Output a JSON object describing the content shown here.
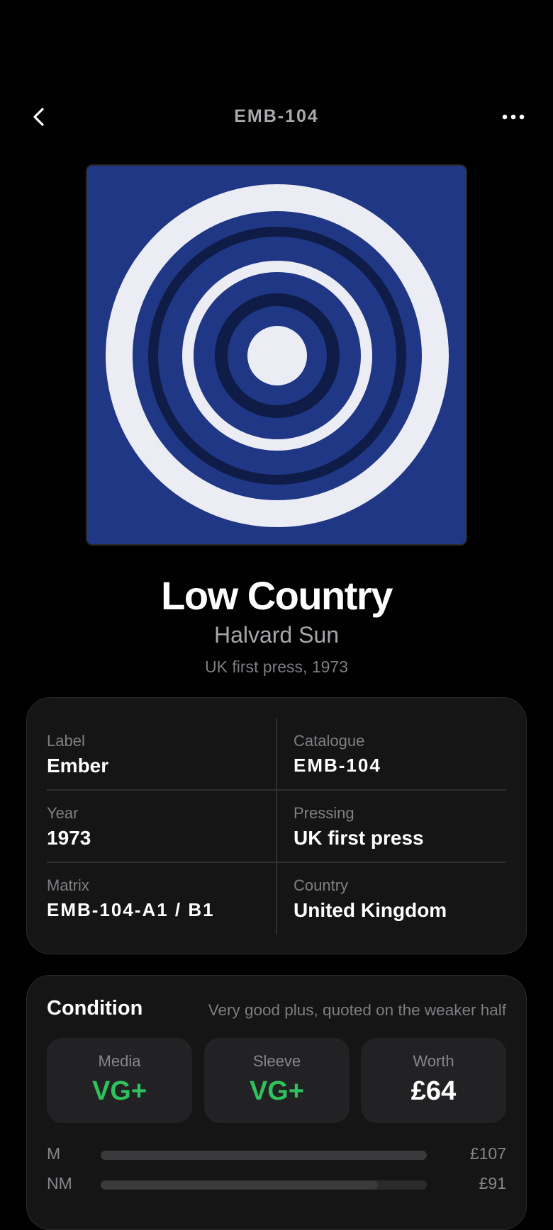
{
  "header": {
    "title": "EMB-104"
  },
  "album": {
    "title": "Low Country",
    "artist": "Halvard Sun",
    "edition": "UK first press, 1973"
  },
  "details": [
    {
      "label": "Label",
      "value": "Ember"
    },
    {
      "label": "Catalogue",
      "value": "EMB-104"
    },
    {
      "label": "Year",
      "value": "1973"
    },
    {
      "label": "Pressing",
      "value": "UK first press"
    },
    {
      "label": "Matrix",
      "value": "EMB-104-A1 / B1"
    },
    {
      "label": "Country",
      "value": "United Kingdom"
    }
  ],
  "condition": {
    "title": "Condition",
    "note": "Very good plus, quoted on the weaker half",
    "media": {
      "label": "Media",
      "grade": "VG+"
    },
    "sleeve": {
      "label": "Sleeve",
      "grade": "VG+"
    },
    "worth": {
      "label": "Worth",
      "value": "£64"
    },
    "price_guide": [
      {
        "grade": "M",
        "price": "£107",
        "level": 1.0
      },
      {
        "grade": "NM",
        "price": "£91",
        "level": 0.85
      }
    ]
  },
  "colors": {
    "cover_blue": "#1f3785",
    "cover_ring_light": "#ecedf4",
    "cover_ring_dark": "#0f1c48",
    "grade_green": "#2fc15b"
  },
  "icons": [
    "chevron-left-icon",
    "more-horizontal-icon"
  ]
}
